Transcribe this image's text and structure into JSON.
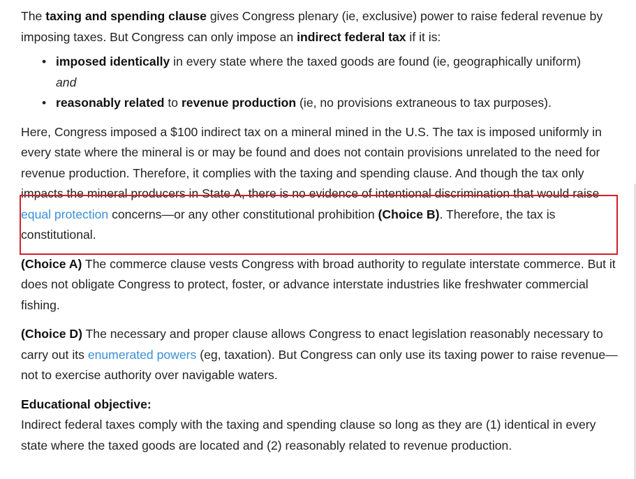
{
  "p1": {
    "t1": "The ",
    "b1": "taxing and spending clause",
    "t2": " gives Congress plenary (ie, exclusive) power to raise federal revenue by imposing taxes.  But Congress can only impose an ",
    "b2": "indirect federal tax",
    "t3": " if it is:"
  },
  "rules": {
    "bullet_glyph": "•",
    "item1": {
      "b1": "imposed identically",
      "t1": " in every state where the taxed goods are found (ie, geographically uniform)",
      "conj": "and"
    },
    "item2": {
      "b1": "reasonably related",
      "t1": " to ",
      "b2": "revenue production",
      "t2": " (ie, no provisions extraneous to tax purposes)."
    }
  },
  "p2": {
    "t1": "Here, Congress imposed a $100 indirect tax on a mineral mined in the U.S.  The tax is imposed uniformly in every state where the mineral is or may be found and does not contain provisions unrelated to the need for revenue production.  Therefore, it complies with the taxing and spending clause.  And though the tax only impacts the mineral producers in State A, there is no evidence of intentional discrimination that would raise ",
    "link1": "equal protection",
    "t2": " concerns—or any other constitutional prohibition ",
    "b1": "(Choice B)",
    "t3": ".  Therefore, the tax is constitutional."
  },
  "p3": {
    "b1": "(Choice A)",
    "t1": "  The commerce clause vests Congress with broad authority to regulate interstate commerce.  But it does not obligate Congress to protect, foster, or advance interstate industries like freshwater commercial fishing."
  },
  "p4": {
    "b1": "(Choice D)",
    "t1": "  The necessary and proper clause allows Congress to enact legislation reasonably necessary to carry out its ",
    "link1": "enumerated powers",
    "t2": " (eg, taxation).  But Congress can only use its taxing power to raise revenue—not to exercise authority over navigable waters."
  },
  "objective": {
    "heading": "Educational objective:",
    "text": "Indirect federal taxes comply with the taxing and spending clause so long as they are (1) identical in every state where the taxed goods are located and (2) reasonably related to revenue production."
  },
  "colors": {
    "text": "#222222",
    "link": "#3a8fd8",
    "highlight_border": "#d11f2c"
  }
}
